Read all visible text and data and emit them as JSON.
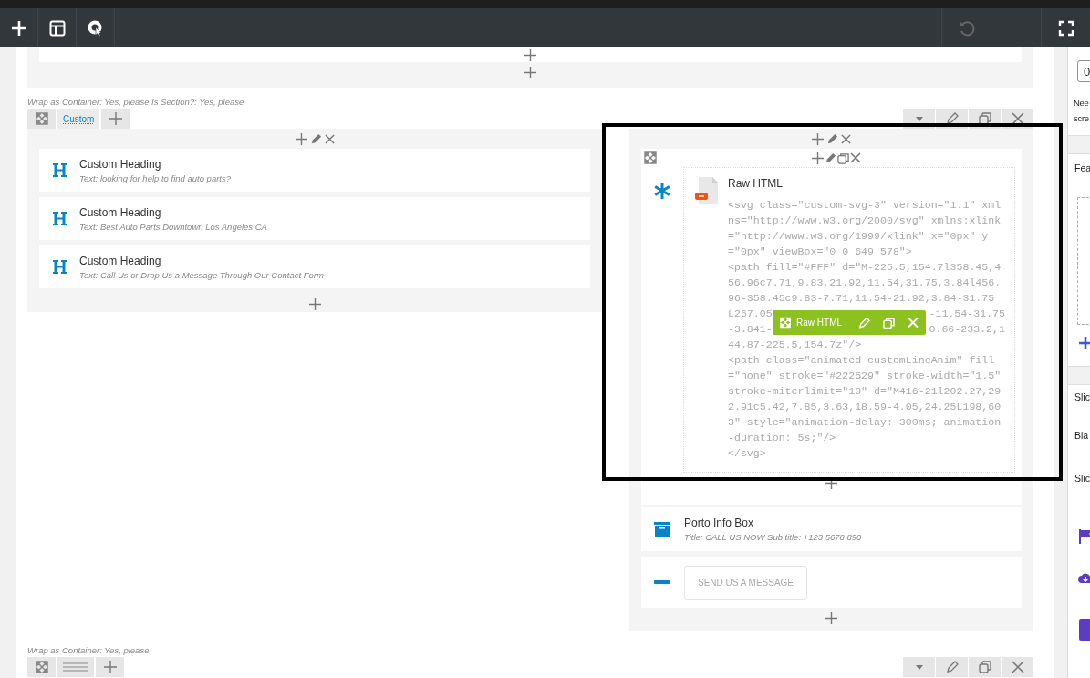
{
  "sections": [
    {
      "meta": "Wrap as Container: Yes, please  Is Section?: Yes, please",
      "tab_label": "Custom"
    },
    {
      "meta": "Wrap as Container: Yes, please"
    }
  ],
  "left_column": {
    "elements": [
      {
        "title": "Custom Heading",
        "text": "Text: looking for help to find auto parts?"
      },
      {
        "title": "Custom Heading",
        "text": "Text: Best Auto Parts Downtown Los Angeles CA"
      },
      {
        "title": "Custom Heading",
        "text": "Text: Call Us or Drop Us a Message Through Our Contact Form"
      }
    ]
  },
  "right_column": {
    "raw_html": {
      "title": "Raw HTML",
      "code_lines": [
        {
          "left": "<svg class=\"custom-svg-3\" version=\"1.1\" xml"
        },
        {
          "left": "ns=\"http://www.w3.org/2000/svg\" xmlns:xlink"
        },
        {
          "left": "=\"http://www.w3.org/1999/xlink\" x=\"0px\" y"
        },
        {
          "left": "=\"0px\" viewBox=\"0 0 649 578\">"
        },
        {
          "left": "<path fill=\"#FFF\" d=\"M-225.5,154.7l358.45,4"
        },
        {
          "left": "56.96c7.71,9.83,21.92,11.54,31.75,3.84l456."
        },
        {
          "left": "96-358.45c9.83-7.71,11.54-21.92,3.84-31.75"
        },
        {
          "left": "L267.05",
          "right": "-11.54-31.75"
        },
        {
          "left": "-3.841-",
          "right": "0.66-233.2,1"
        },
        {
          "left": "44.87-225.5,154.7z\"/>"
        },
        {
          "left": "<path class=\"animated customLineAnim\" fill"
        },
        {
          "left": "=\"none\" stroke=\"#222529\" stroke-width=\"1.5\""
        },
        {
          "left": "stroke-miterlimit=\"10\" d=\"M416-21l202.27,29"
        },
        {
          "left": "2.91c5.42,7.85,3.63,18.59-4.05,24.25L198,60"
        },
        {
          "left": "3\" style=\"animation-delay: 300ms; animation"
        },
        {
          "left": "-duration: 5s;\"/>"
        },
        {
          "left": "</svg>"
        }
      ]
    },
    "hover_toolbar_label": "Raw HTML",
    "info_box": {
      "title": "Porto Info Box",
      "subtitle": "Title: CALL US NOW  Sub title: +123 5678 890"
    },
    "button": {
      "label": "SEND US A MESSAGE"
    }
  },
  "side_panel": {
    "input_value": "0",
    "note_lines": [
      "Nee",
      "scre"
    ],
    "headers": [
      "Fea",
      "Slic"
    ],
    "labels": [
      "Bla",
      "Slic"
    ]
  }
}
